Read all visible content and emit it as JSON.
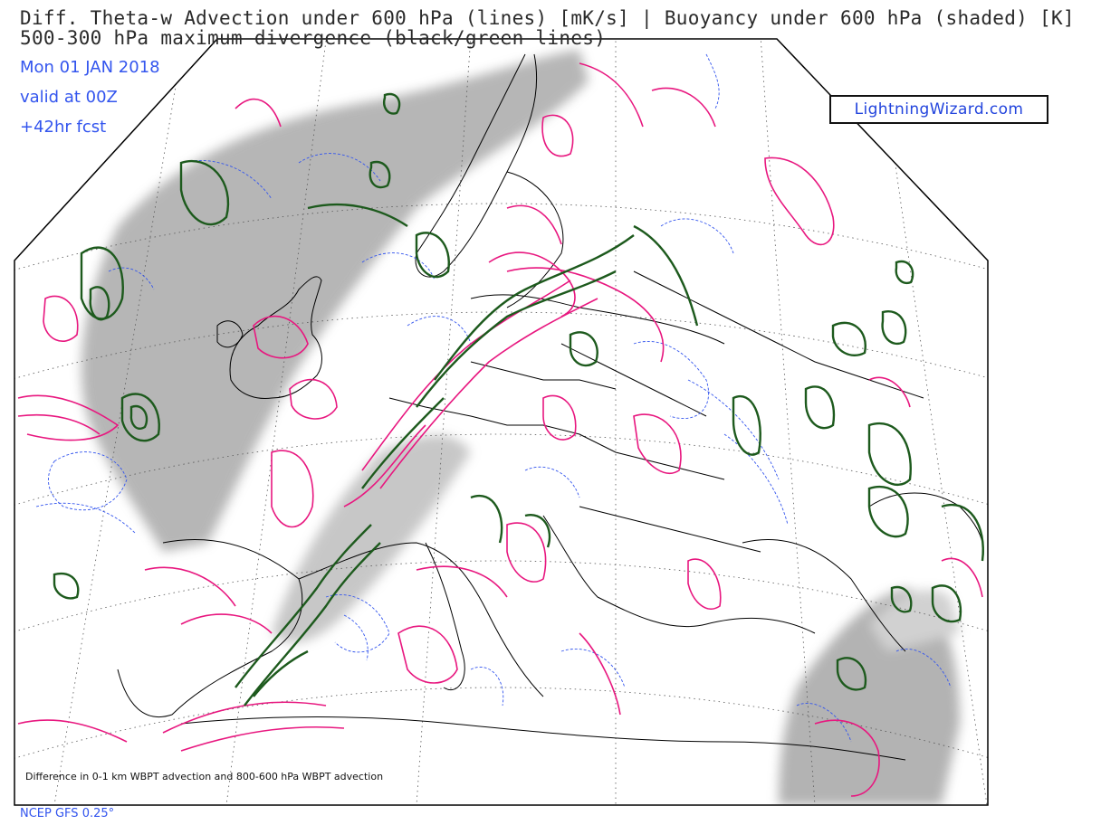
{
  "header": {
    "title_line1": "Diff. Theta-w Advection under 600 hPa (lines) [mK/s]  |  Buoyancy under 600 hPa (shaded) [K]",
    "title_line2": "500-300 hPa maximum divergence (black/green lines)",
    "date": "Mon 01 JAN 2018",
    "valid": "valid at 00Z",
    "forecast": "+42hr fcst"
  },
  "brand": {
    "label": "LightningWizard.com"
  },
  "map": {
    "footnote": "Difference in 0-1 km WBPT advection and 800-600 hPa WBPT advection",
    "model": "NCEP GFS 0.25°",
    "colors": {
      "buoyancy_shade": "#a8a8a8",
      "advection_positive": "#e8177f",
      "advection_negative": "#3355ee",
      "divergence": "#1d5a1d",
      "coastline": "#000000",
      "gridlines": "#555555"
    }
  }
}
